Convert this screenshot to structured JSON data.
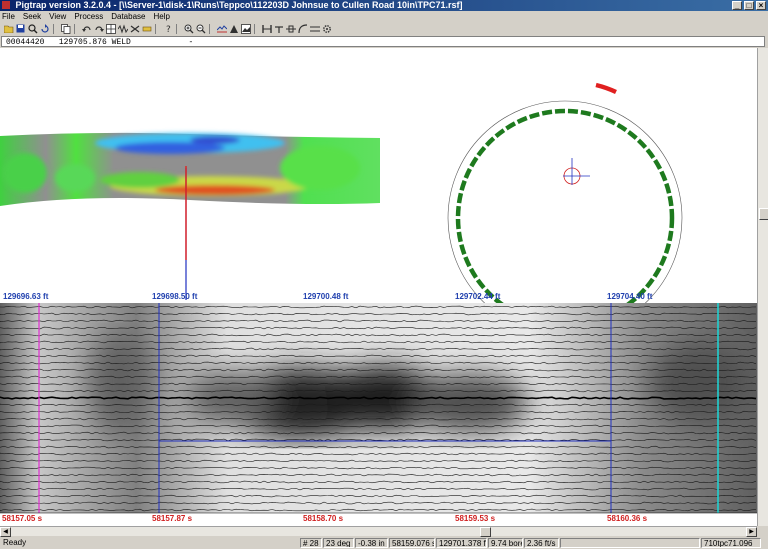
{
  "window": {
    "title": "Pigtrap version 3.2.0.4 - [\\\\Server-1\\disk-1\\Runs\\Teppco\\112203D Johnsue to Cullen Road 10in\\TPC71.rsf]",
    "buttons": [
      "_",
      "□",
      "×"
    ]
  },
  "menu": {
    "items": [
      "File",
      "Seek",
      "View",
      "Process",
      "Database",
      "Help"
    ]
  },
  "infobar": {
    "record": "00044420",
    "distance": "129705.876",
    "feature": "WELD",
    "extra": "-"
  },
  "distance_labels": [
    "129696.63 ft",
    "129698.50 ft",
    "129700.48 ft",
    "129702.44 ft",
    "129704.40 ft"
  ],
  "time_labels": [
    "58157.05 s",
    "58157.87 s",
    "58158.70 s",
    "58159.53 s",
    "58160.36 s"
  ],
  "status": {
    "ready": "Ready",
    "cells": [
      "# 28",
      "23 deg",
      "-0.38 in",
      "58159.076 s",
      "129701.378 ft",
      "9.74 bore",
      "2.36 ft/s",
      "",
      "710tpc71.096"
    ]
  },
  "colors": {
    "title_start": "#0a246a",
    "title_end": "#3a6ea5",
    "distance_label": "#1f3fae",
    "time_label": "#d02020",
    "sensor_ring": "#1e7a1e",
    "sensor_alert": "#e02020",
    "cursor_line": "#1f3fae",
    "magenta_marker": "#e030d0",
    "cyan_marker": "#20d0d0"
  }
}
